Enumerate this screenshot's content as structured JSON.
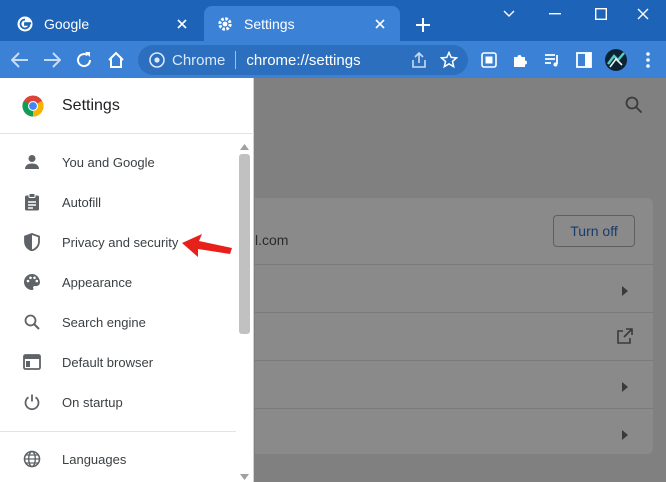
{
  "tabs": [
    {
      "label": "Google",
      "icon": "google-icon"
    },
    {
      "label": "Settings",
      "icon": "gear-icon"
    }
  ],
  "toolbar": {
    "omnibox_site": "Chrome",
    "omnibox_url": "chrome://settings"
  },
  "drawer": {
    "title": "Settings",
    "items": [
      {
        "label": "You and Google",
        "icon": "person-icon"
      },
      {
        "label": "Autofill",
        "icon": "clipboard-icon"
      },
      {
        "label": "Privacy and security",
        "icon": "shield-icon"
      },
      {
        "label": "Appearance",
        "icon": "palette-icon"
      },
      {
        "label": "Search engine",
        "icon": "search-icon"
      },
      {
        "label": "Default browser",
        "icon": "browser-window-icon"
      },
      {
        "label": "On startup",
        "icon": "power-icon"
      },
      {
        "label": "Languages",
        "icon": "globe-icon"
      }
    ]
  },
  "page": {
    "email_fragment": "l.com",
    "turn_off_label": "Turn off"
  },
  "colors": {
    "tabstrip": "#1d64b8",
    "toolbar": "#3b82d6",
    "annotation_arrow": "#e8201a"
  }
}
